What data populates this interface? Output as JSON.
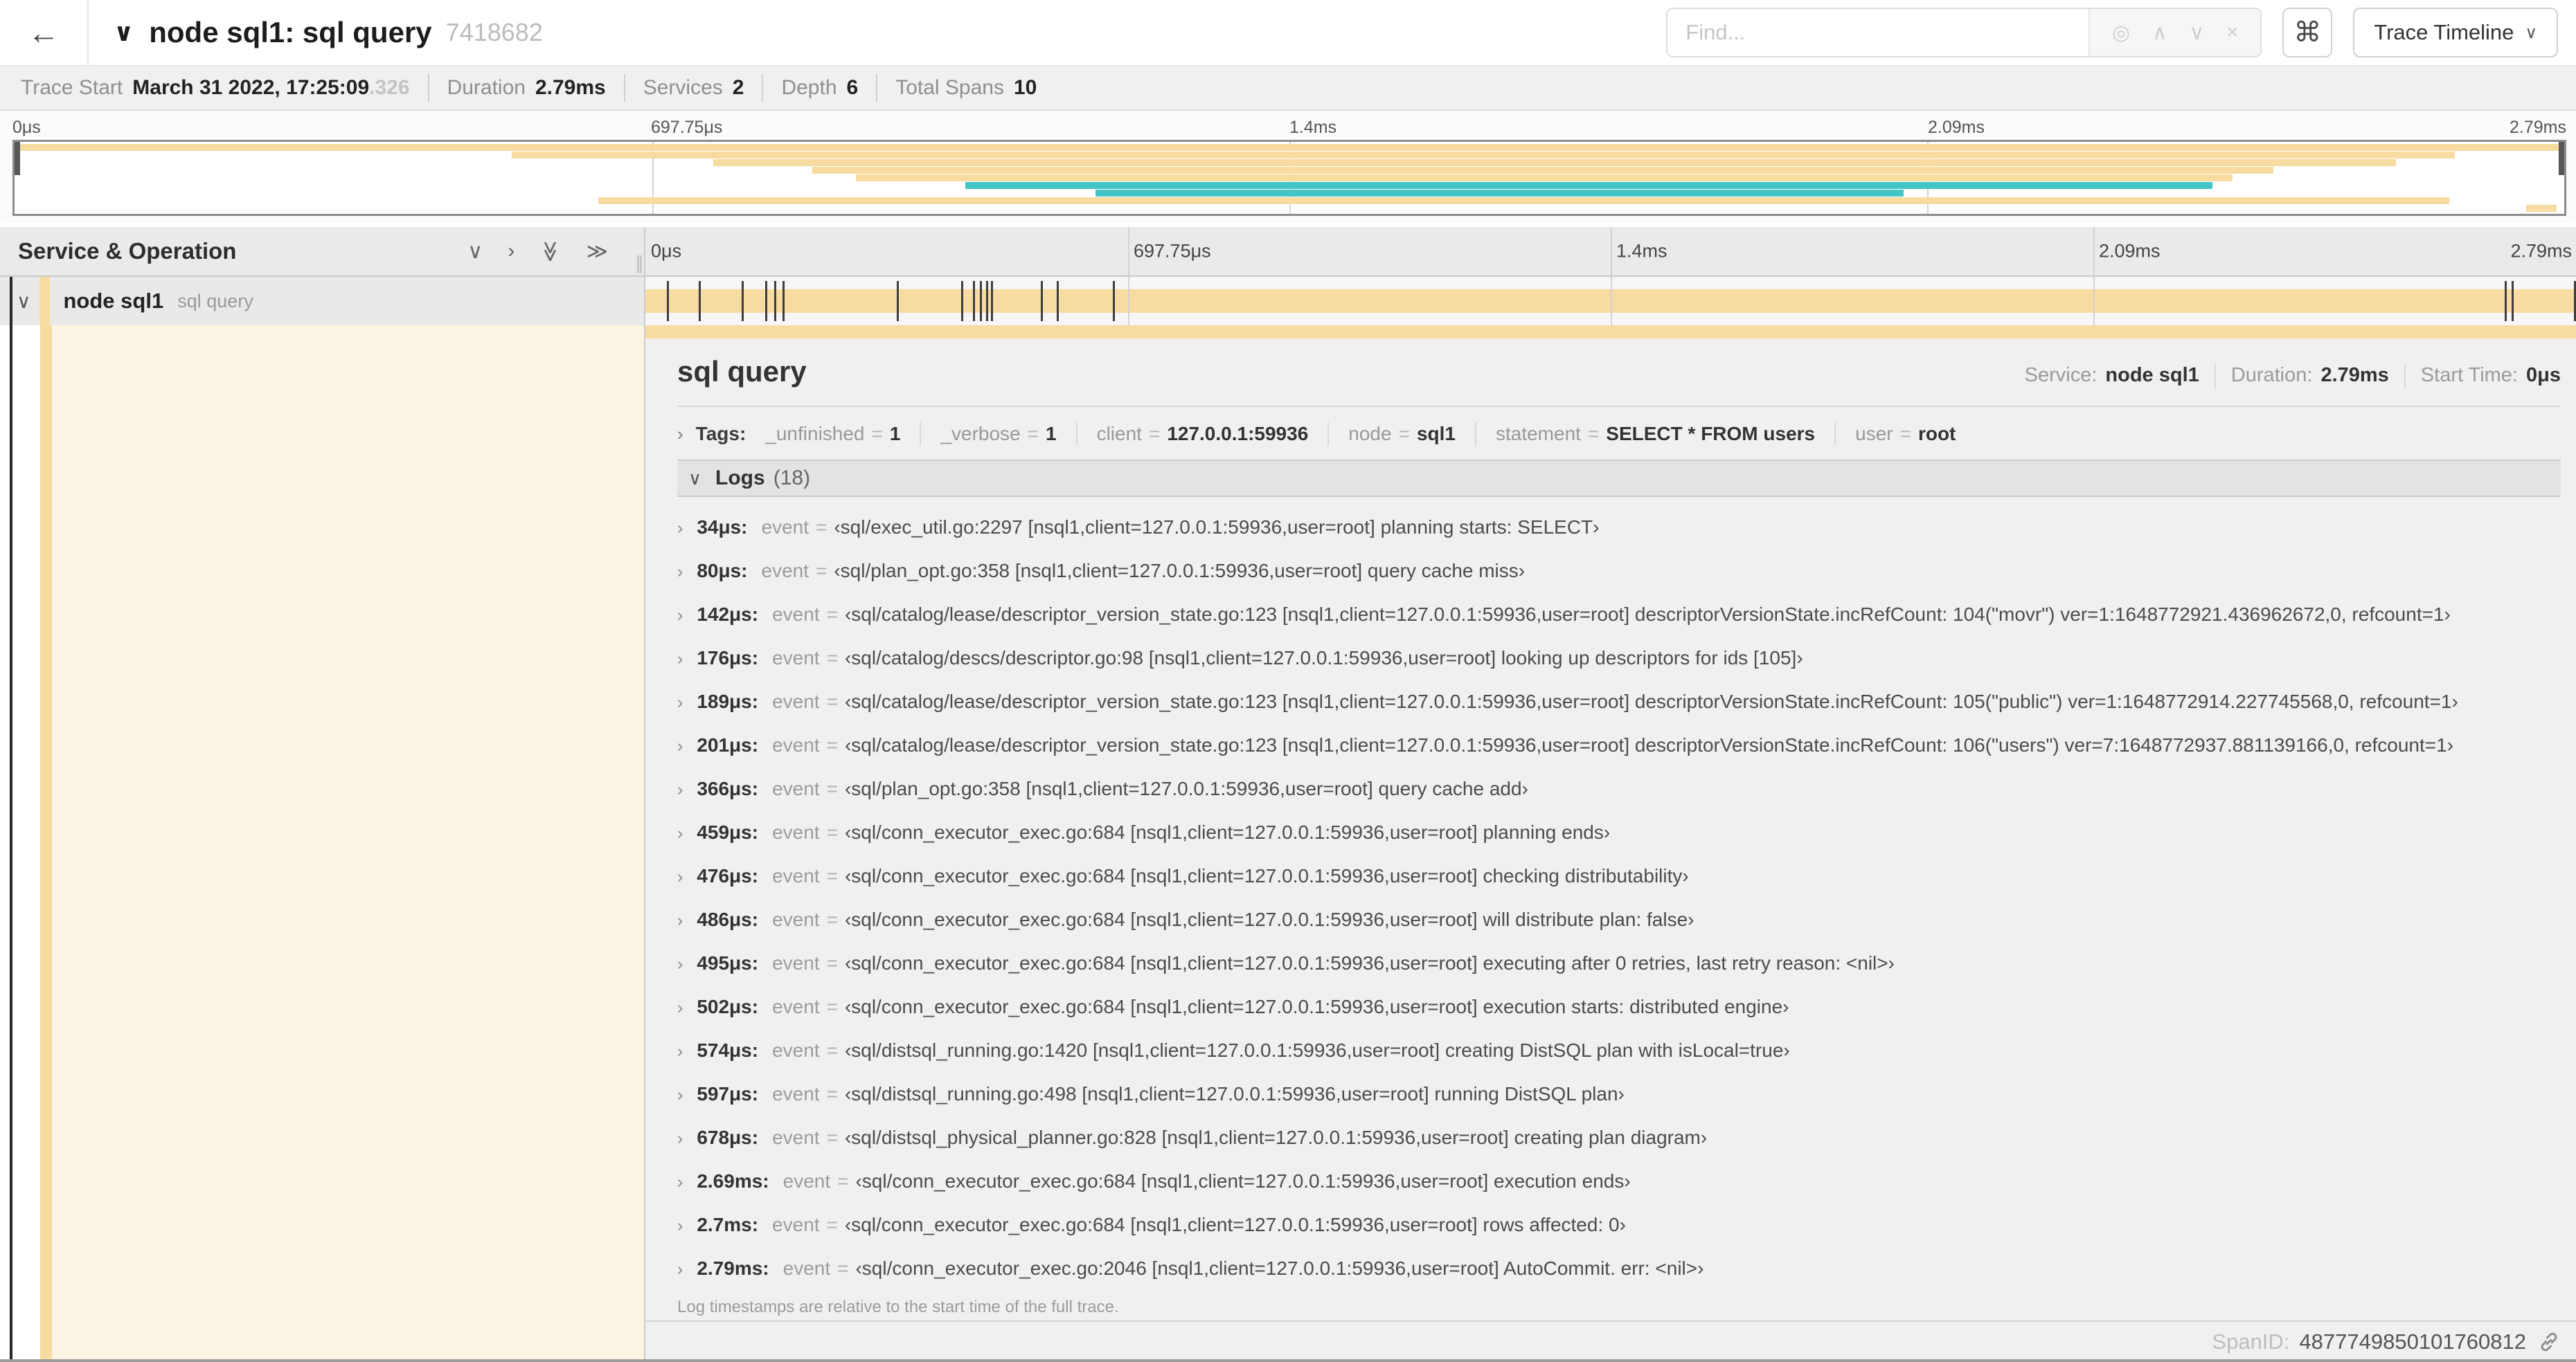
{
  "colors": {
    "span": "#f7dba0",
    "alt": "#43c4c6",
    "cream": "#fcf4e2"
  },
  "header": {
    "back_icon": "←",
    "collapse_icon": "∨",
    "title": "node sql1: sql query",
    "trace_id": "7418682",
    "find_placeholder": "Find...",
    "find_icons": [
      "◎",
      "∧",
      "∨",
      "×"
    ],
    "shortcut_icon": "⌘",
    "view_button": "Trace Timeline",
    "view_caret": "∨"
  },
  "summary": {
    "items": [
      {
        "label": "Trace Start",
        "value": "March 31 2022, 17:25:09",
        "suffix": ".326"
      },
      {
        "label": "Duration",
        "value": "2.79ms"
      },
      {
        "label": "Services",
        "value": "2"
      },
      {
        "label": "Depth",
        "value": "6"
      },
      {
        "label": "Total Spans",
        "value": "10"
      }
    ]
  },
  "timeline": {
    "ticks": [
      "0μs",
      "697.75μs",
      "1.4ms",
      "2.09ms",
      "2.79ms"
    ],
    "tick_positions": [
      0,
      25,
      50,
      75,
      100
    ],
    "total_us": 2790,
    "log_marks_us": [
      34,
      80,
      142,
      176,
      189,
      201,
      366,
      459,
      476,
      486,
      495,
      502,
      574,
      597,
      678,
      2690,
      2700,
      2790
    ],
    "minimap_spans": [
      {
        "row": 0,
        "start": 0.0,
        "end": 1.0,
        "color": "span"
      },
      {
        "row": 1,
        "start": 0.195,
        "end": 0.957,
        "color": "span"
      },
      {
        "row": 2,
        "start": 0.274,
        "end": 0.934,
        "color": "span"
      },
      {
        "row": 3,
        "start": 0.313,
        "end": 0.886,
        "color": "span"
      },
      {
        "row": 4,
        "start": 0.33,
        "end": 0.87,
        "color": "span"
      },
      {
        "row": 5,
        "start": 0.373,
        "end": 0.862,
        "color": "alt"
      },
      {
        "row": 6,
        "start": 0.424,
        "end": 0.741,
        "color": "alt"
      },
      {
        "row": 7,
        "start": 0.229,
        "end": 0.955,
        "color": "span"
      },
      {
        "row": 8,
        "start": 0.985,
        "end": 0.997,
        "color": "span"
      }
    ]
  },
  "grid": {
    "left_title": "Service & Operation",
    "collapse_icons": [
      "∨",
      "›",
      "≫",
      "≫"
    ],
    "grip": "∥"
  },
  "span_row": {
    "collapse_icon": "∨",
    "service": "node sql1",
    "operation": "sql query"
  },
  "detail": {
    "title": "sql query",
    "meta": [
      {
        "label": "Service:",
        "value": "node sql1"
      },
      {
        "label": "Duration:",
        "value": "2.79ms"
      },
      {
        "label": "Start Time:",
        "value": "0μs"
      }
    ],
    "tags_chevron": "›",
    "tags_label": "Tags:",
    "tags": [
      {
        "key": "_unfinished",
        "eq": "=",
        "value": "1"
      },
      {
        "key": "_verbose",
        "eq": "=",
        "value": "1"
      },
      {
        "key": "client",
        "eq": "=",
        "value": "127.0.0.1:59936"
      },
      {
        "key": "node",
        "eq": "=",
        "value": "sql1"
      },
      {
        "key": "statement",
        "eq": "=",
        "value": "SELECT * FROM users"
      },
      {
        "key": "user",
        "eq": "=",
        "value": "root"
      }
    ],
    "logs_chevron": "∨",
    "logs_label": "Logs",
    "logs_count": "(18)",
    "log_chevron": "›",
    "log_key": "event",
    "log_eq": "=",
    "logs": [
      {
        "time": "34μs:",
        "value": "‹sql/exec_util.go:2297 [nsql1,client=127.0.0.1:59936,user=root] planning starts: SELECT›"
      },
      {
        "time": "80μs:",
        "value": "‹sql/plan_opt.go:358 [nsql1,client=127.0.0.1:59936,user=root] query cache miss›"
      },
      {
        "time": "142μs:",
        "value": "‹sql/catalog/lease/descriptor_version_state.go:123 [nsql1,client=127.0.0.1:59936,user=root] descriptorVersionState.incRefCount: 104(\"movr\") ver=1:1648772921.436962672,0, refcount=1›"
      },
      {
        "time": "176μs:",
        "value": "‹sql/catalog/descs/descriptor.go:98 [nsql1,client=127.0.0.1:59936,user=root] looking up descriptors for ids [105]›"
      },
      {
        "time": "189μs:",
        "value": "‹sql/catalog/lease/descriptor_version_state.go:123 [nsql1,client=127.0.0.1:59936,user=root] descriptorVersionState.incRefCount: 105(\"public\") ver=1:1648772914.227745568,0, refcount=1›"
      },
      {
        "time": "201μs:",
        "value": "‹sql/catalog/lease/descriptor_version_state.go:123 [nsql1,client=127.0.0.1:59936,user=root] descriptorVersionState.incRefCount: 106(\"users\") ver=7:1648772937.881139166,0, refcount=1›"
      },
      {
        "time": "366μs:",
        "value": "‹sql/plan_opt.go:358 [nsql1,client=127.0.0.1:59936,user=root] query cache add›"
      },
      {
        "time": "459μs:",
        "value": "‹sql/conn_executor_exec.go:684 [nsql1,client=127.0.0.1:59936,user=root] planning ends›"
      },
      {
        "time": "476μs:",
        "value": "‹sql/conn_executor_exec.go:684 [nsql1,client=127.0.0.1:59936,user=root] checking distributability›"
      },
      {
        "time": "486μs:",
        "value": "‹sql/conn_executor_exec.go:684 [nsql1,client=127.0.0.1:59936,user=root] will distribute plan: false›"
      },
      {
        "time": "495μs:",
        "value": "‹sql/conn_executor_exec.go:684 [nsql1,client=127.0.0.1:59936,user=root] executing after 0 retries, last retry reason: <nil>›"
      },
      {
        "time": "502μs:",
        "value": "‹sql/conn_executor_exec.go:684 [nsql1,client=127.0.0.1:59936,user=root] execution starts: distributed engine›"
      },
      {
        "time": "574μs:",
        "value": "‹sql/distsql_running.go:1420 [nsql1,client=127.0.0.1:59936,user=root] creating DistSQL plan with isLocal=true›"
      },
      {
        "time": "597μs:",
        "value": "‹sql/distsql_running.go:498 [nsql1,client=127.0.0.1:59936,user=root] running DistSQL plan›"
      },
      {
        "time": "678μs:",
        "value": "‹sql/distsql_physical_planner.go:828 [nsql1,client=127.0.0.1:59936,user=root] creating plan diagram›"
      },
      {
        "time": "2.69ms:",
        "value": "‹sql/conn_executor_exec.go:684 [nsql1,client=127.0.0.1:59936,user=root] execution ends›"
      },
      {
        "time": "2.7ms:",
        "value": "‹sql/conn_executor_exec.go:684 [nsql1,client=127.0.0.1:59936,user=root] rows affected: 0›"
      },
      {
        "time": "2.79ms:",
        "value": "‹sql/conn_executor_exec.go:2046 [nsql1,client=127.0.0.1:59936,user=root] AutoCommit. err: <nil>›"
      }
    ],
    "note": "Log timestamps are relative to the start time of the full trace.",
    "spanid_label": "SpanID:",
    "spanid_value": "4877749850101760812"
  }
}
